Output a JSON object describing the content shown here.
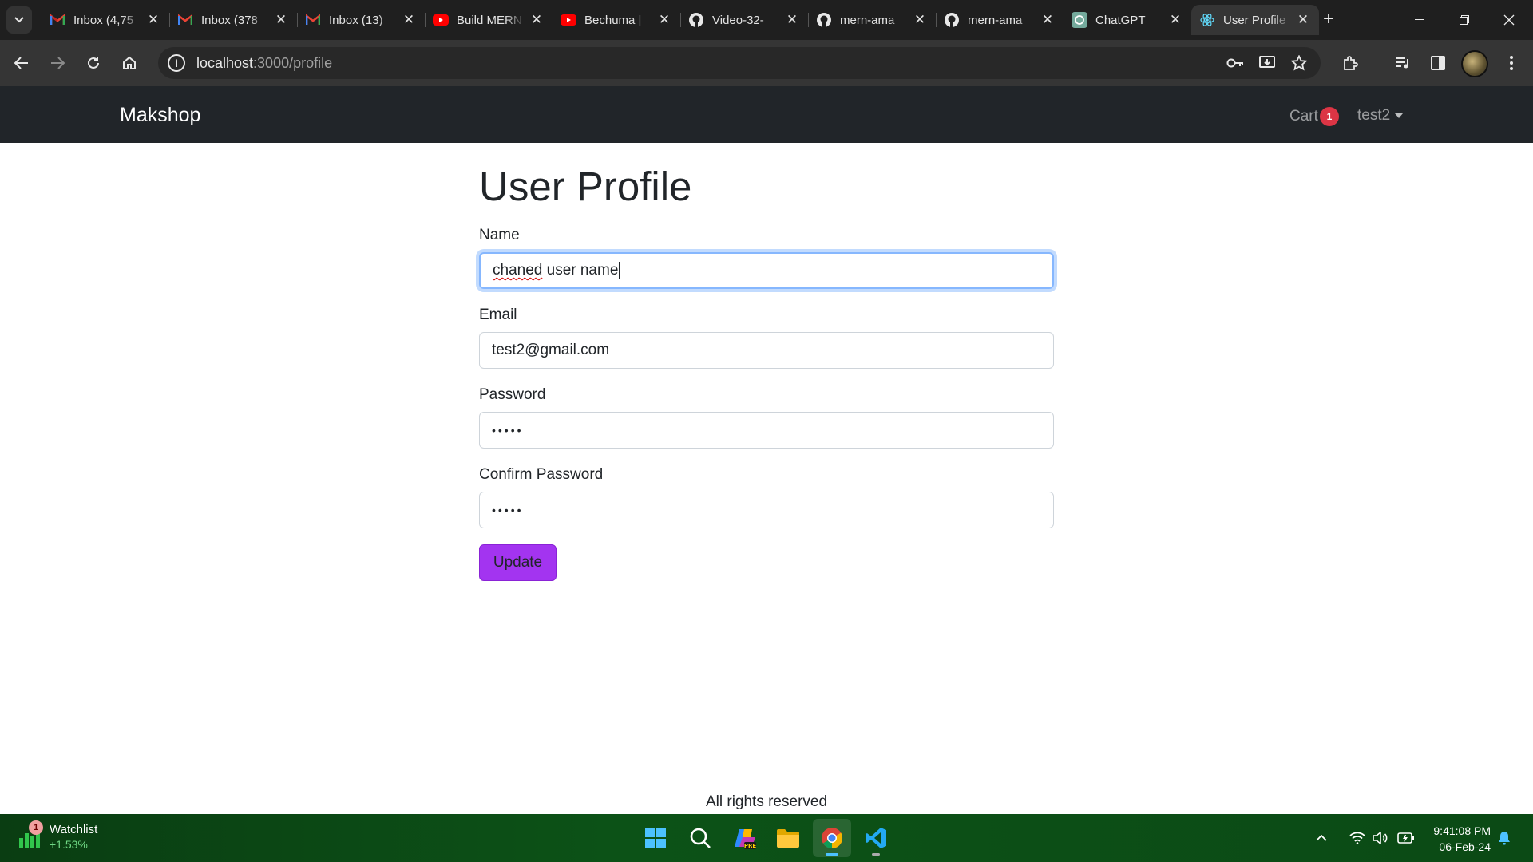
{
  "browser": {
    "tabs": [
      {
        "title": "Inbox (4,75",
        "icon": "gmail-icon"
      },
      {
        "title": "Inbox (378",
        "icon": "gmail-icon"
      },
      {
        "title": "Inbox (13)",
        "icon": "gmail-icon"
      },
      {
        "title": "Build MERN",
        "icon": "youtube-icon"
      },
      {
        "title": "Bechuma |",
        "icon": "youtube-icon"
      },
      {
        "title": "Video-32-",
        "icon": "github-icon"
      },
      {
        "title": "mern-ama",
        "icon": "github-icon"
      },
      {
        "title": "mern-ama",
        "icon": "github-icon"
      },
      {
        "title": "ChatGPT",
        "icon": "chatgpt-icon"
      },
      {
        "title": "User Profile",
        "icon": "react-icon",
        "active": true
      }
    ],
    "url_host": "localhost",
    "url_path": ":3000/profile"
  },
  "navbar": {
    "brand": "Makshop",
    "cart_label": "Cart",
    "cart_count": "1",
    "user_name": "test2"
  },
  "profile": {
    "title": "User Profile",
    "name_label": "Name",
    "name_value_misspelled": "chaned",
    "name_value_rest": " user name",
    "email_label": "Email",
    "email_value": "test2@gmail.com",
    "password_label": "Password",
    "password_mask": "•••••",
    "confirm_label": "Confirm Password",
    "confirm_mask": "•••••",
    "update_button": "Update"
  },
  "footer": {
    "text": "All rights reserved"
  },
  "taskbar": {
    "watchlist_title": "Watchlist",
    "watchlist_change": "+1.53%",
    "watchlist_badge": "1",
    "time": "9:41:08 PM",
    "date": "06-Feb-24"
  },
  "colors": {
    "navbar_bg": "#212529",
    "badge_red": "#dc3545",
    "update_purple": "#a334f0",
    "focus_blue": "#86b7fe"
  }
}
